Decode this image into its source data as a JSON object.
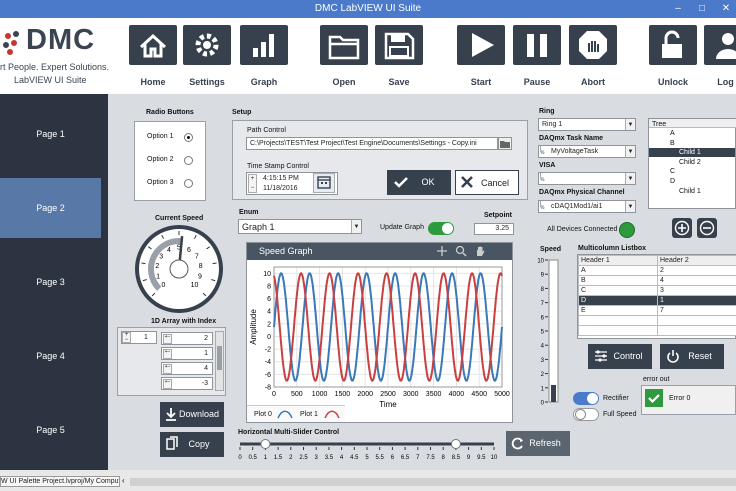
{
  "window": {
    "title": "DMC LabVIEW UI Suite",
    "controls": [
      "–",
      "□",
      "✕"
    ]
  },
  "logo": {
    "name": "DMC",
    "tagline": "rt People. Expert Solutions.",
    "subtitle": "LabVIEW UI Suite"
  },
  "toolbar": [
    {
      "label": "Home",
      "icon": "home-icon"
    },
    {
      "label": "Settings",
      "icon": "gear-icon"
    },
    {
      "label": "Graph",
      "icon": "bar-chart-icon"
    },
    {
      "label": "Open",
      "icon": "folder-icon"
    },
    {
      "label": "Save",
      "icon": "floppy-icon"
    },
    {
      "label": "Start",
      "icon": "play-icon"
    },
    {
      "label": "Pause",
      "icon": "pause-icon"
    },
    {
      "label": "Abort",
      "icon": "stop-hand-icon"
    },
    {
      "label": "Unlock",
      "icon": "unlock-icon"
    },
    {
      "label": "Log I",
      "icon": "user-icon"
    }
  ],
  "nav": [
    {
      "label": "Page 1",
      "active": false
    },
    {
      "label": "Page 2",
      "active": true
    },
    {
      "label": "Page 3",
      "active": false
    },
    {
      "label": "Page 4",
      "active": false
    },
    {
      "label": "Page 5",
      "active": false
    }
  ],
  "radio": {
    "title": "Radio Buttons",
    "options": [
      "Option 1",
      "Option 2",
      "Option 3"
    ],
    "selected_index": 0
  },
  "setup": {
    "title": "Setup",
    "path_label": "Path Control",
    "path_value": "C:\\Projects\\TEST\\Test Project\\Test Engine\\Documents\\Settings - Copy.ini",
    "timestamp_label": "Time Stamp Control",
    "time": "4:15:15 PM",
    "date": "11/18/2016",
    "ok_label": "OK",
    "cancel_label": "Cancel"
  },
  "speed_gauge": {
    "label": "Current Speed",
    "value": 5.2,
    "ticks": [
      "0",
      "1",
      "2",
      "3",
      "4",
      "5",
      "6",
      "7",
      "8",
      "9",
      "10"
    ]
  },
  "array": {
    "label": "1D Array with Index",
    "index": "1",
    "values": [
      "2",
      "1",
      "4",
      "-3"
    ]
  },
  "download_label": "Download",
  "copy_label": "Copy",
  "enum": {
    "label": "Enum",
    "value": "Graph 1"
  },
  "update_graph": {
    "label": "Update Graph",
    "on": true
  },
  "setpoint": {
    "label": "Setpoint",
    "value": "3.25"
  },
  "graph": {
    "title": "Speed Graph",
    "xlabel": "Time",
    "ylabel": "Amplitude",
    "xticks": [
      "0",
      "500",
      "1000",
      "1500",
      "2000",
      "2500",
      "3000",
      "3500",
      "4000",
      "4500",
      "5000"
    ],
    "yticks": [
      "10",
      "8",
      "6",
      "4",
      "2",
      "0",
      "-2",
      "-4",
      "-6",
      "-8"
    ],
    "legend": [
      "Plot 0",
      "Plot 1"
    ],
    "colors": {
      "plot0": "#3a78b8",
      "plot1": "#c94040"
    }
  },
  "slider": {
    "label": "Horizontal Multi-Slider Control",
    "ticks": [
      "0",
      "0.5",
      "1",
      "1.5",
      "2",
      "2.5",
      "3",
      "3.5",
      "4",
      "4.5",
      "5",
      "5.5",
      "6",
      "6.5",
      "7",
      "7.5",
      "8",
      "8.5",
      "9",
      "9.5",
      "10"
    ],
    "thumb_values": [
      1,
      8.5
    ]
  },
  "refresh_label": "Refresh",
  "ring": {
    "label": "Ring",
    "value": "Ring 1"
  },
  "daqmx_task": {
    "label": "DAQmx Task Name",
    "value": "MyVoltageTask"
  },
  "visa": {
    "label": "VISA",
    "value": ""
  },
  "daqmx_channel": {
    "label": "DAQmx Physical Channel",
    "value": "cDAQ1Mod1/ai1"
  },
  "devices": {
    "label": "All Devices Connected",
    "status_color": "#2e9a3e"
  },
  "speed_vertical": {
    "label": "Speed",
    "ticks": [
      "10",
      "9",
      "8",
      "7",
      "6",
      "5",
      "4",
      "3",
      "2",
      "1",
      "0"
    ],
    "level": 0.12
  },
  "rectifier": {
    "label": "Rectifier",
    "on": true
  },
  "full_speed": {
    "label": "Full Speed",
    "on": false
  },
  "tree": {
    "header": "Tree",
    "items": [
      {
        "label": "A",
        "level": 0,
        "selected": false
      },
      {
        "label": "B",
        "level": 0,
        "selected": false
      },
      {
        "label": "Child 1",
        "level": 1,
        "selected": true
      },
      {
        "label": "Child 2",
        "level": 1,
        "selected": false
      },
      {
        "label": "C",
        "level": 0,
        "selected": false
      },
      {
        "label": "D",
        "level": 0,
        "selected": false
      },
      {
        "label": "Child 1",
        "level": 1,
        "selected": false
      }
    ]
  },
  "listbox": {
    "label": "Multicolumn Listbox",
    "headers": [
      "Header 1",
      "Header 2"
    ],
    "rows": [
      [
        "A",
        "2"
      ],
      [
        "B",
        "4"
      ],
      [
        "C",
        "3"
      ],
      [
        "D",
        "1"
      ],
      [
        "E",
        "7"
      ]
    ],
    "selected_row": 3
  },
  "control_label": "Control",
  "reset_label": "Reset",
  "error": {
    "label": "error out",
    "text": "Error 0"
  },
  "status": {
    "project_tab": "W UI Palette Project.lvproj/My Computer"
  }
}
